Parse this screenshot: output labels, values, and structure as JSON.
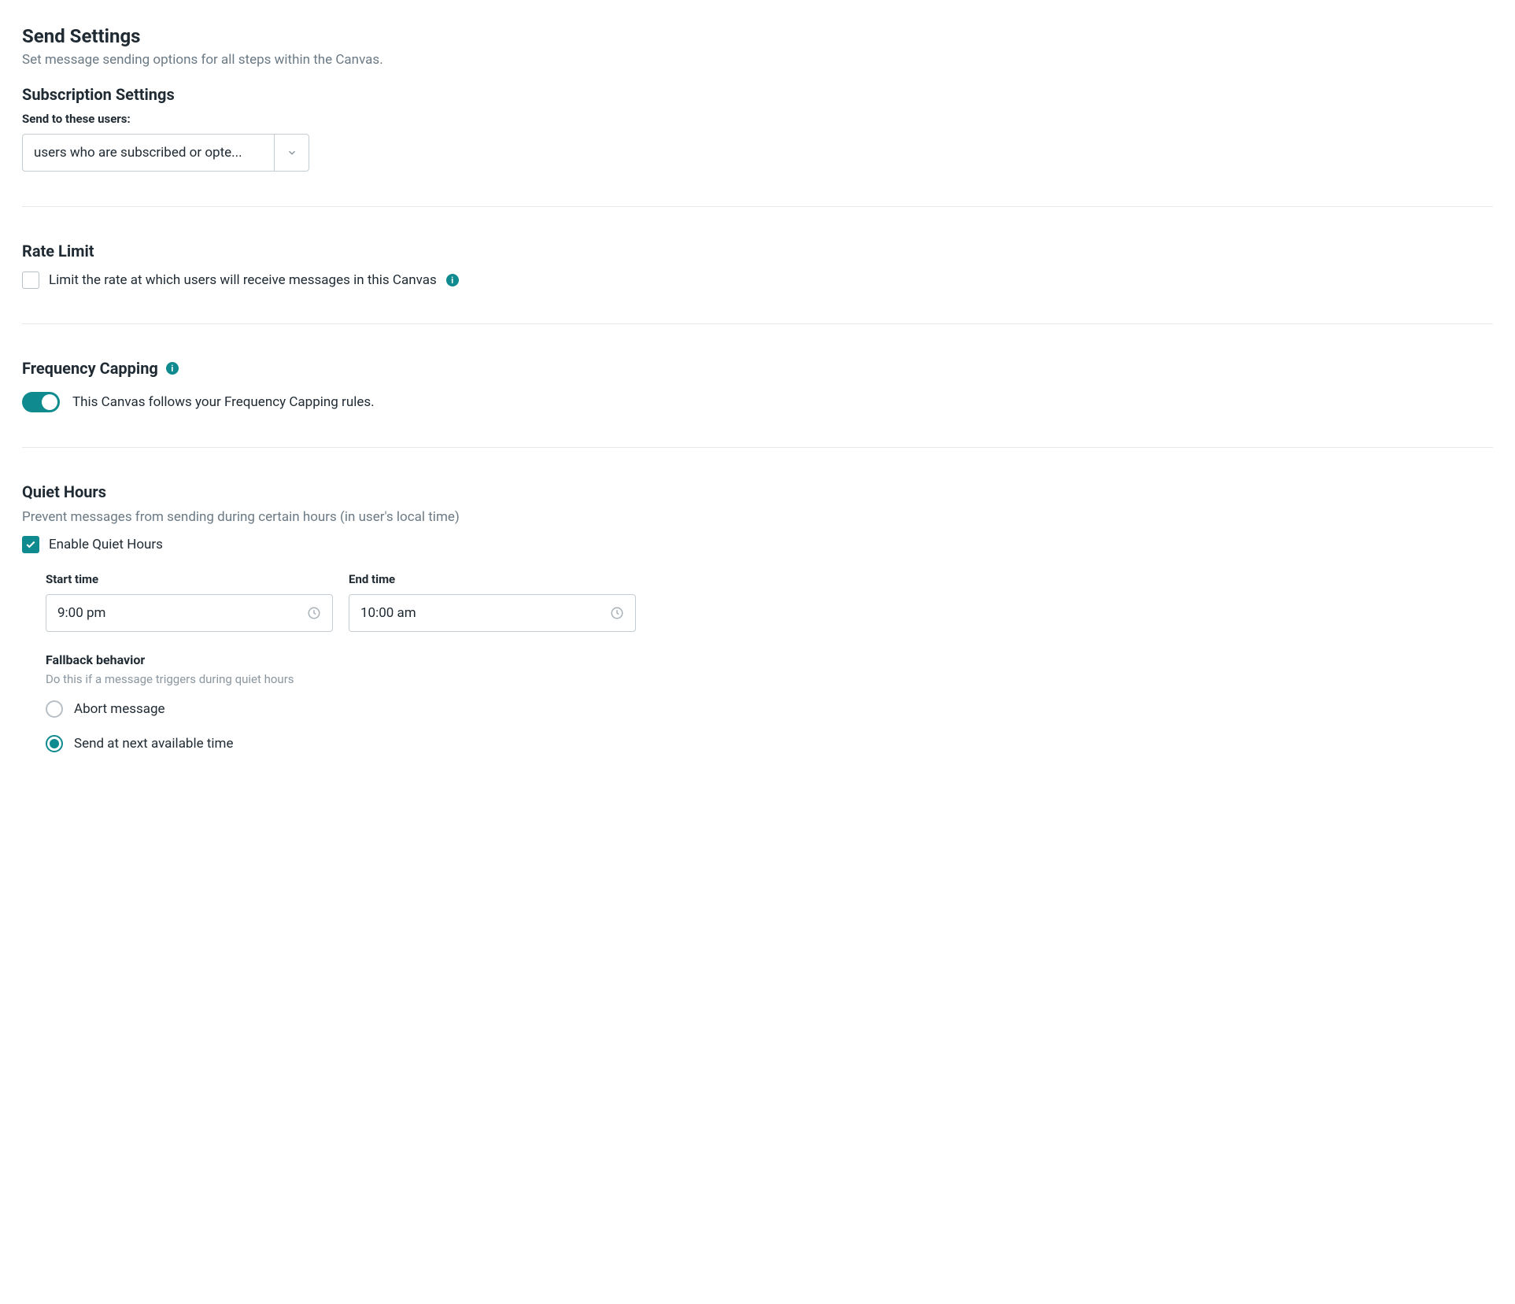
{
  "page": {
    "title": "Send Settings",
    "subtitle": "Set message sending options for all steps within the Canvas."
  },
  "subscription": {
    "heading": "Subscription Settings",
    "field_label": "Send to these users:",
    "selected": "users who are subscribed or opte..."
  },
  "rate_limit": {
    "heading": "Rate Limit",
    "checkbox_label": "Limit the rate at which users will receive messages in this Canvas",
    "checked": false
  },
  "frequency_capping": {
    "heading": "Frequency Capping",
    "toggle_label": "This Canvas follows your Frequency Capping rules.",
    "enabled": true
  },
  "quiet_hours": {
    "heading": "Quiet Hours",
    "description": "Prevent messages from sending during certain hours (in user's local time)",
    "enable_label": "Enable Quiet Hours",
    "enabled": true,
    "start_label": "Start time",
    "start_value": "9:00 pm",
    "end_label": "End time",
    "end_value": "10:00 am",
    "fallback": {
      "heading": "Fallback behavior",
      "description": "Do this if a message triggers during quiet hours",
      "options": [
        {
          "label": "Abort message",
          "selected": false
        },
        {
          "label": "Send at next available time",
          "selected": true
        }
      ]
    }
  }
}
